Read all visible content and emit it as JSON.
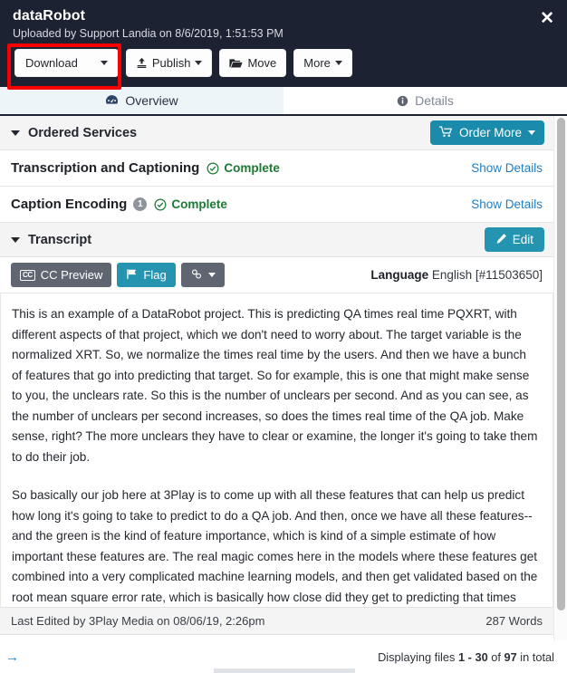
{
  "header": {
    "title": "dataRobot",
    "subtitle": "Uploaded by Support Landia on 8/6/2019, 1:51:53 PM",
    "close_label": "✕",
    "buttons": [
      {
        "label": "Download",
        "icon": "none",
        "caret": true,
        "split": true
      },
      {
        "label": "Publish",
        "icon": "upload-icon",
        "caret": true,
        "split": false
      },
      {
        "label": "Move",
        "icon": "folder-open-icon",
        "caret": false,
        "split": false
      },
      {
        "label": "More",
        "icon": "none",
        "caret": true,
        "split": false
      }
    ]
  },
  "tabs": [
    {
      "label": "Overview",
      "icon": "dashboard-icon",
      "active": true
    },
    {
      "label": "Details",
      "icon": "info-circle-icon",
      "active": false
    }
  ],
  "ordered_services": {
    "title": "Ordered Services",
    "order_more_label": "Order More",
    "order_more_icon": "shopping-cart-icon",
    "rows": [
      {
        "name": "Transcription and Captioning",
        "count": null,
        "status": "Complete",
        "action": "Show Details"
      },
      {
        "name": "Caption Encoding",
        "count": "1",
        "status": "Complete",
        "action": "Show Details"
      }
    ]
  },
  "transcript": {
    "title": "Transcript",
    "edit_label": "Edit",
    "edit_icon": "pencil-icon",
    "toolbar": [
      {
        "label": "CC Preview",
        "icon": "cc-icon",
        "style": "gray"
      },
      {
        "label": "Flag",
        "icon": "flag-icon",
        "style": "teal"
      },
      {
        "label": "",
        "icon": "link-icon",
        "style": "gray",
        "caret": true
      }
    ],
    "language_label": "Language",
    "language_value": "English [#11503650]",
    "paragraphs": [
      "This is an example of a DataRobot project. This is predicting QA times real time PQXRT, with different aspects of that project, which we don't need to worry about. The target variable is the normalized XRT. So, we normalize the times real time by the users. And then we have a bunch of features that go into predicting that target. So for example, this is one that might make sense to you, the unclears rate. So this is the number of unclears per second. And as you can see, as the number of unclears per second increases, so does the times real time of the QA job. Make sense, right? The more unclears they have to clear or examine, the longer it's going to take them to do their job.",
      "So basically our job here at 3Play is to come up with all these features that can help us predict how long it's going to take to predict to do a QA job. And then, once we have all these features-- and the green is the kind of feature importance, which is kind of a simple estimate of how important these features are. The real magic comes here in the models where these features get combined into a very complicated machine learning models, and then get validated based on the root mean square error rate, which is basically how close did they get to predicting that times real time."
    ],
    "last_edited": "Last Edited by 3Play Media on 08/06/19, 2:26pm",
    "word_count": "287 Words"
  },
  "bottom": {
    "arrow_icon": "arrow-right-icon",
    "displaying_prefix": "Displaying files ",
    "displaying_range": "1 - 30",
    "displaying_mid": " of ",
    "displaying_total": "97",
    "displaying_suffix": " in total"
  },
  "colors": {
    "header_bg": "#1c2232",
    "accent_teal": "#2494b0",
    "order_blue": "#1b8bab",
    "link_blue": "#1f7fc4",
    "status_green": "#1d7a33",
    "annotation_red": "#f80000"
  }
}
